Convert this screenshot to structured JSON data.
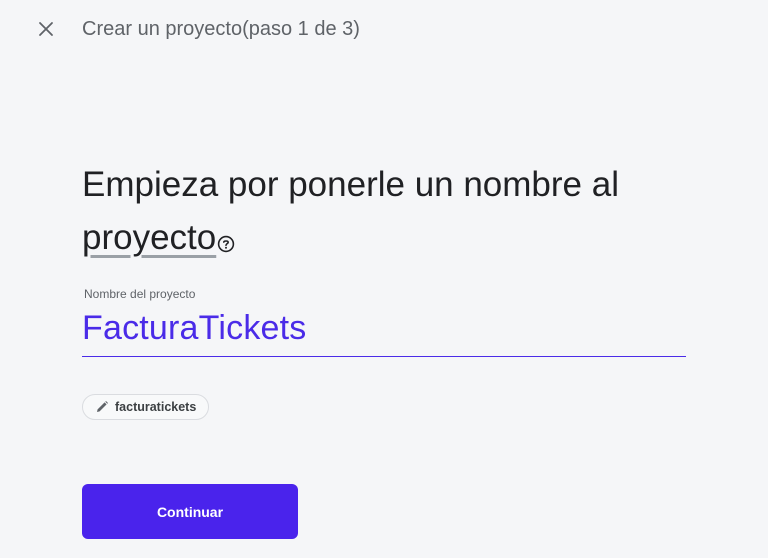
{
  "header": {
    "close_icon": "close-icon",
    "title": "Crear un proyecto(paso 1 de 3)"
  },
  "main": {
    "headline_part1": "Empieza por ponerle un nombre al ",
    "headline_term": "proyecto",
    "help_icon": "help-circle-icon"
  },
  "field": {
    "label": "Nombre del proyecto",
    "value": "FacturaTickets"
  },
  "chip": {
    "icon": "pencil-icon",
    "label": "facturatickets"
  },
  "footer": {
    "continue_label": "Continuar"
  },
  "colors": {
    "accent": "#4a23ec",
    "background": "#f5f6f8",
    "text_primary": "#202124",
    "text_secondary": "#5f6368"
  }
}
